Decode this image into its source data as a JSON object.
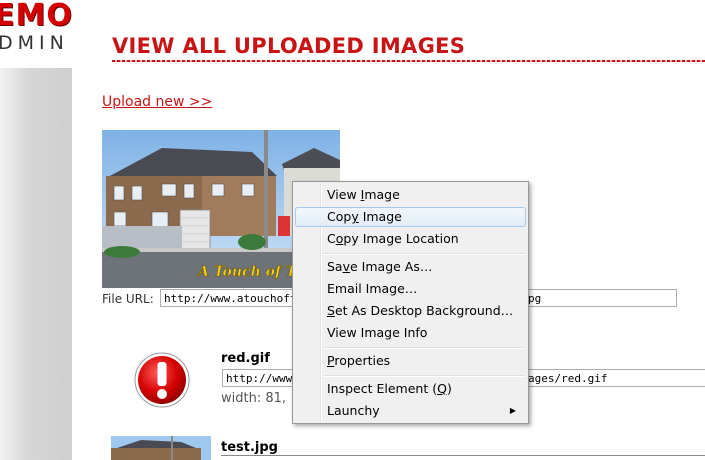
{
  "logo": {
    "text": "EMO",
    "sub": "DMIN"
  },
  "page": {
    "title": "VIEW ALL UPLOADED IMAGES",
    "upload_link": "Upload new >>"
  },
  "images": [
    {
      "file_url_label": "File URL:",
      "url_left": "http://www.atouchofte",
      "url_right": "pg",
      "photo_caption": "A Touch of T"
    },
    {
      "name": "red.gif",
      "url_left": "http://www.",
      "url_right": "ages/red.gif",
      "dims": "width: 81,"
    },
    {
      "name": "test.jpg"
    }
  ],
  "context_menu": {
    "items": [
      {
        "pre": "View ",
        "key": "I",
        "post": "mage"
      },
      {
        "pre": "Cop",
        "key": "y",
        "post": " Image",
        "highlighted": true
      },
      {
        "pre": "C",
        "key": "o",
        "post": "py Image Location"
      },
      {
        "pre": "Sa",
        "key": "v",
        "post": "e Image As…"
      },
      {
        "pre": "E",
        "key": "",
        "post": "mail Image…",
        "full": "Email Image…",
        "key2": "a"
      },
      {
        "pre": "",
        "key": "S",
        "post": "et As Desktop Background…"
      },
      {
        "pre": "View Image Info",
        "key": "",
        "post": ""
      },
      {
        "pre": "",
        "key": "P",
        "post": "roperties"
      },
      {
        "pre": "Inspect Element (",
        "key": "Q",
        "post": ")"
      },
      {
        "pre": "Launchy",
        "key": "",
        "post": "",
        "submenu": true
      }
    ]
  },
  "colors": {
    "accent": "#c81414",
    "menu_bg": "#f0f0f0",
    "menu_highlight": "#e2ecf8"
  }
}
